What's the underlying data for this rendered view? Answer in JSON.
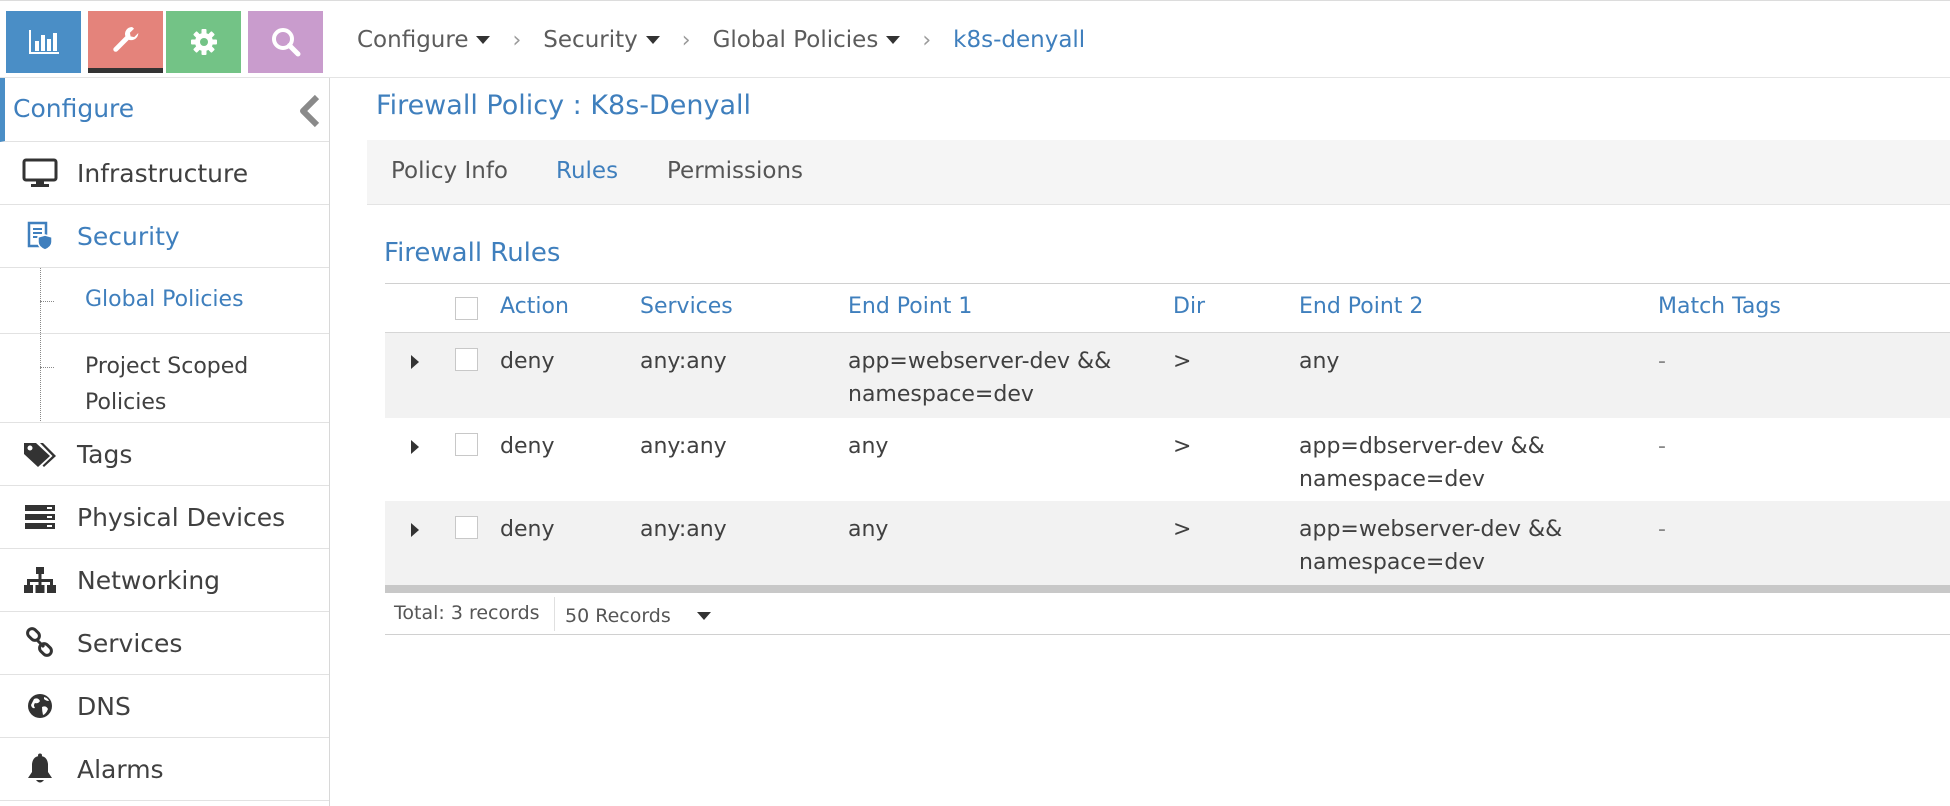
{
  "topnav": {
    "buttons": [
      {
        "name": "monitor",
        "icon": "bar-chart-icon",
        "color": "#4a8ec6"
      },
      {
        "name": "configure",
        "icon": "wrench-icon",
        "color": "#e4837b"
      },
      {
        "name": "settings",
        "icon": "gear-icon",
        "color": "#73c386"
      },
      {
        "name": "query",
        "icon": "search-icon",
        "color": "#c99ccd"
      }
    ]
  },
  "breadcrumb": {
    "items": [
      "Configure",
      "Security",
      "Global Policies",
      "k8s-denyall"
    ]
  },
  "sidebar": {
    "title": "Configure",
    "items": [
      {
        "label": "Infrastructure",
        "icon": "monitor-icon"
      },
      {
        "label": "Security",
        "icon": "security-document-icon"
      },
      {
        "label": "Tags",
        "icon": "tags-icon"
      },
      {
        "label": "Physical Devices",
        "icon": "server-stack-icon"
      },
      {
        "label": "Networking",
        "icon": "network-tree-icon"
      },
      {
        "label": "Services",
        "icon": "link-icon"
      },
      {
        "label": "DNS",
        "icon": "globe-icon"
      },
      {
        "label": "Alarms",
        "icon": "bell-icon"
      }
    ],
    "subitems": [
      {
        "label": "Global Policies"
      },
      {
        "label_line1": "Project Scoped",
        "label_line2": "Policies"
      }
    ]
  },
  "page": {
    "title": "Firewall Policy : K8s-Denyall"
  },
  "tabs": [
    "Policy Info",
    "Rules",
    "Permissions"
  ],
  "rules": {
    "section_title": "Firewall Rules",
    "columns": [
      "Action",
      "Services",
      "End Point 1",
      "Dir",
      "End Point 2",
      "Match Tags"
    ],
    "rows": [
      {
        "action": "deny",
        "services": "any:any",
        "ep1_line1": "app=webserver-dev &&",
        "ep1_line2": "namespace=dev",
        "dir": ">",
        "ep2_line1": "any",
        "ep2_line2": "",
        "tags": "-"
      },
      {
        "action": "deny",
        "services": "any:any",
        "ep1_line1": "any",
        "ep1_line2": "",
        "dir": ">",
        "ep2_line1": "app=dbserver-dev &&",
        "ep2_line2": "namespace=dev",
        "tags": "-"
      },
      {
        "action": "deny",
        "services": "any:any",
        "ep1_line1": "any",
        "ep1_line2": "",
        "dir": ">",
        "ep2_line1": "app=webserver-dev &&",
        "ep2_line2": "namespace=dev",
        "tags": "-"
      }
    ],
    "footer": {
      "total": "Total: 3 records",
      "page_size": "50 Records"
    }
  }
}
